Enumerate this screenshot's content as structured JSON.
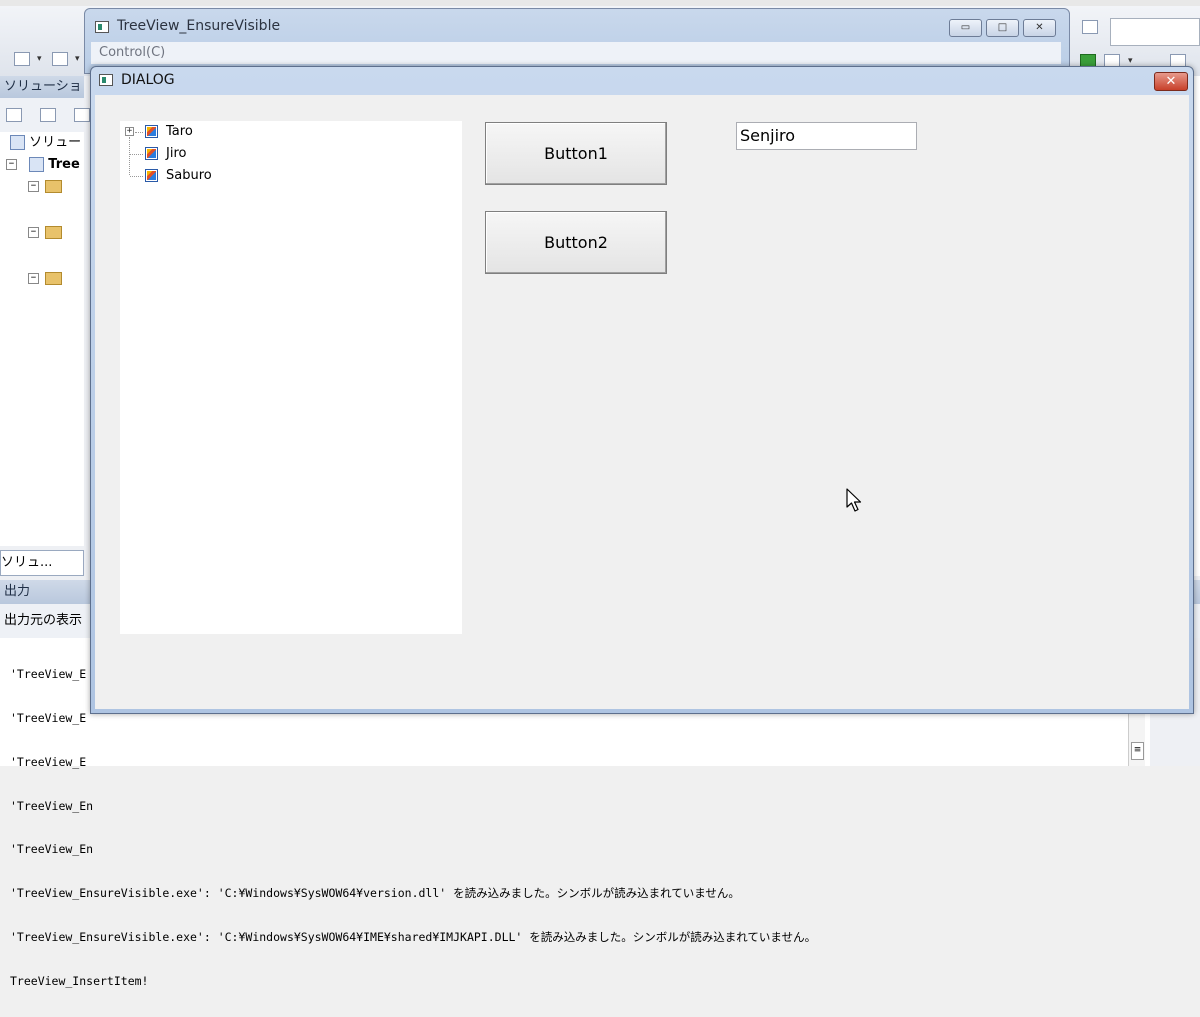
{
  "ide": {
    "solution_header": "ソリューショ",
    "solution_root": "ソリュー",
    "project_name": "Tree",
    "solution_tab": "ソリュ...",
    "output_header": "出力",
    "output_source_label": "出力元の表示",
    "output_lines": [
      "'TreeView_E",
      "'TreeView_E",
      "'TreeView_E",
      "'TreeView_En",
      "'TreeView_En",
      "'TreeView_EnsureVisible.exe': 'C:¥Windows¥SysWOW64¥version.dll' を読み込みました。シンボルが読み込まれていません。",
      "'TreeView_EnsureVisible.exe': 'C:¥Windows¥SysWOW64¥IME¥shared¥IMJKAPI.DLL' を読み込みました。シンボルが読み込まれていません。",
      "TreeView_InsertItem!"
    ]
  },
  "app_window": {
    "title": "TreeView_EnsureVisible",
    "menu": "Control(C)"
  },
  "dialog": {
    "title": "DIALOG",
    "close_glyph": "✕",
    "tree_items": [
      {
        "label": "Taro",
        "expandable": true,
        "expander": "+"
      },
      {
        "label": "Jiro",
        "expandable": false
      },
      {
        "label": "Saburo",
        "expandable": false
      }
    ],
    "button1_label": "Button1",
    "button2_label": "Button2",
    "edit_value": "Senjiro"
  }
}
